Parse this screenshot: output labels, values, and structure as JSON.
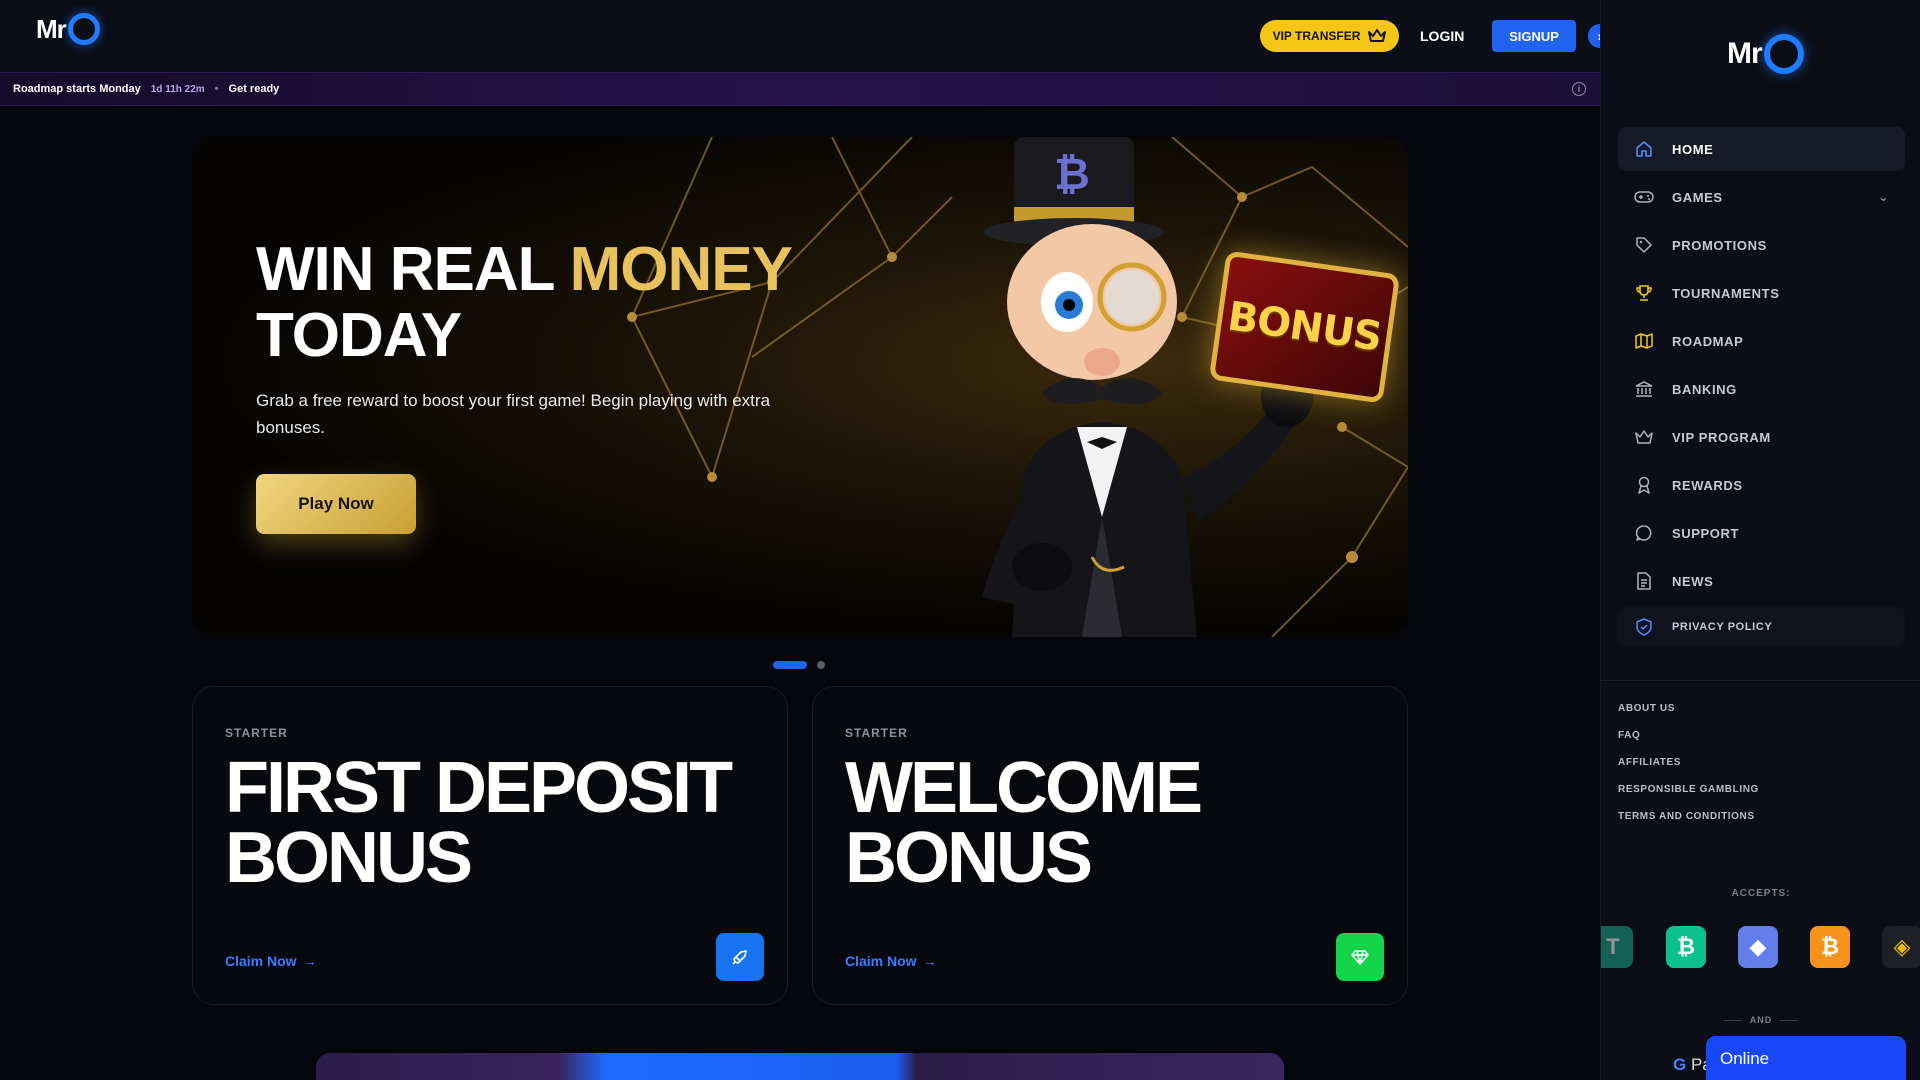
{
  "header": {
    "logo_text": "Mr",
    "logo_o": "O",
    "vip_label": "VIP TRANSFER",
    "login_label": "LOGIN",
    "signup_label": "SIGNUP",
    "collapse_glyph": "›"
  },
  "announcement": {
    "title": "Roadmap starts Monday",
    "countdown": "1d 11h 22m",
    "separator": "•",
    "cta": "Get ready",
    "info_glyph": "i"
  },
  "hero": {
    "headline_white": "WIN REAL ",
    "headline_gold": "MONEY",
    "headline_line2": "TODAY",
    "subtitle": "Grab a free reward to boost your first game! Begin playing with extra bonuses.",
    "cta": "Play Now",
    "sign_text": "BONUS",
    "hat_emblem": "₿",
    "slide_count": 2,
    "active_slide": 1
  },
  "cards": [
    {
      "eyebrow": "STARTER",
      "title_line1": "FIRST DEPOSIT",
      "title_line2": "BONUS",
      "cta": "Claim Now",
      "icon": "rocket-icon",
      "badge_color": "#1773f0"
    },
    {
      "eyebrow": "STARTER",
      "title_line1": "WELCOME",
      "title_line2": "BONUS",
      "cta": "Claim Now",
      "icon": "gem-icon",
      "badge_color": "#13d44a"
    }
  ],
  "sidebar": {
    "logo_text": "Mr",
    "nav": [
      {
        "label": "HOME",
        "icon": "home-icon",
        "active": true
      },
      {
        "label": "GAMES",
        "icon": "gamepad-icon",
        "has_dropdown": true
      },
      {
        "label": "PROMOTIONS",
        "icon": "tag-icon"
      },
      {
        "label": "TOURNAMENTS",
        "icon": "trophy-icon"
      },
      {
        "label": "ROADMAP",
        "icon": "map-icon"
      },
      {
        "label": "BANKING",
        "icon": "bank-icon"
      },
      {
        "label": "VIP PROGRAM",
        "icon": "crown-icon"
      },
      {
        "label": "REWARDS",
        "icon": "ribbon-icon"
      },
      {
        "label": "SUPPORT",
        "icon": "chat-bubble-icon"
      },
      {
        "label": "NEWS",
        "icon": "document-icon"
      },
      {
        "label": "PRIVACY POLICY",
        "icon": "shield-icon"
      }
    ],
    "footer_links": [
      "ABOUT US",
      "FAQ",
      "AFFILIATES",
      "RESPONSIBLE GAMBLING",
      "TERMS AND CONDITIONS"
    ],
    "accepts_label": "ACCEPTS:",
    "coins": [
      {
        "symbol": "T",
        "name": "tether-coin-icon",
        "color": "#1aa58a"
      },
      {
        "symbol": "₿",
        "name": "bitcoin-cash-coin-icon",
        "color": "#0ac18e"
      },
      {
        "symbol": "◆",
        "name": "ethereum-coin-icon",
        "color": "#627eea"
      },
      {
        "symbol": "₿",
        "name": "bitcoin-coin-icon",
        "color": "#f7931a"
      },
      {
        "symbol": "◈",
        "name": "binance-coin-icon",
        "color": "#1e2026"
      }
    ],
    "and_label": "AND",
    "gpay_label": "Pa"
  },
  "chat": {
    "label": "Online"
  },
  "colors": {
    "accent_blue": "#1f63f0",
    "gold": "#e8c25c",
    "vip_yellow": "#f5c518"
  }
}
